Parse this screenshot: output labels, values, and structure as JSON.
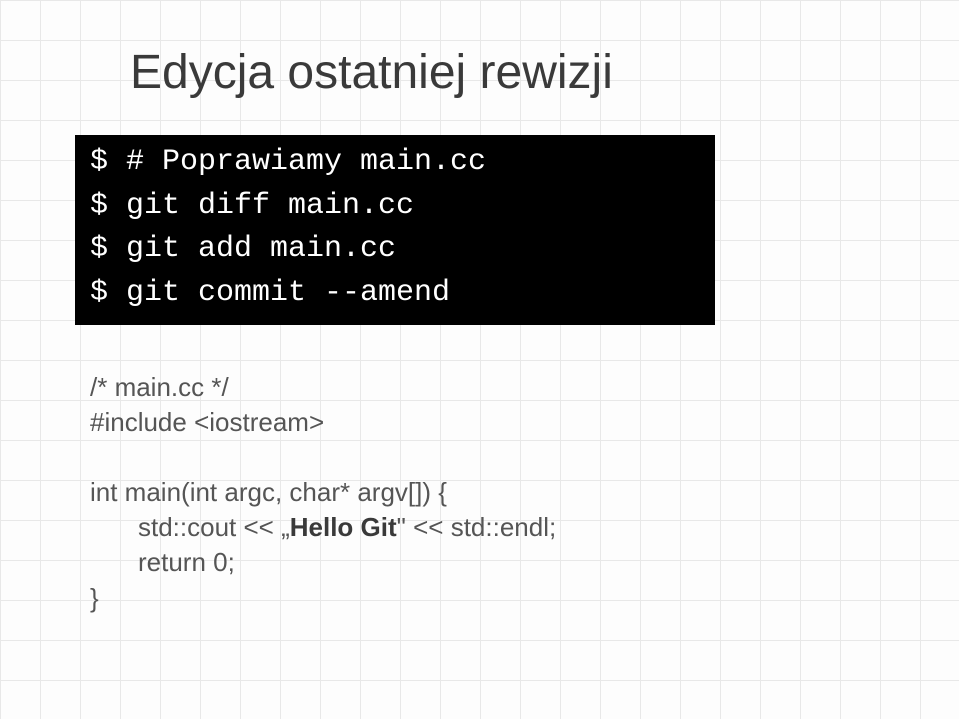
{
  "slide": {
    "title": "Edycja ostatniej rewizji"
  },
  "terminal": {
    "lines": [
      "$ # Poprawiamy main.cc",
      "$ git diff main.cc",
      "$ git add main.cc",
      "$ git commit --amend"
    ]
  },
  "code": {
    "comment": "/* main.cc */",
    "include": "#include <iostream>",
    "func_sig": "int main(int argc, char* argv[]) {",
    "cout_prefix": "std::cout << „",
    "cout_bold": "Hello Git",
    "cout_suffix": "\" << std::endl;",
    "return": "return 0;",
    "close": "}"
  }
}
